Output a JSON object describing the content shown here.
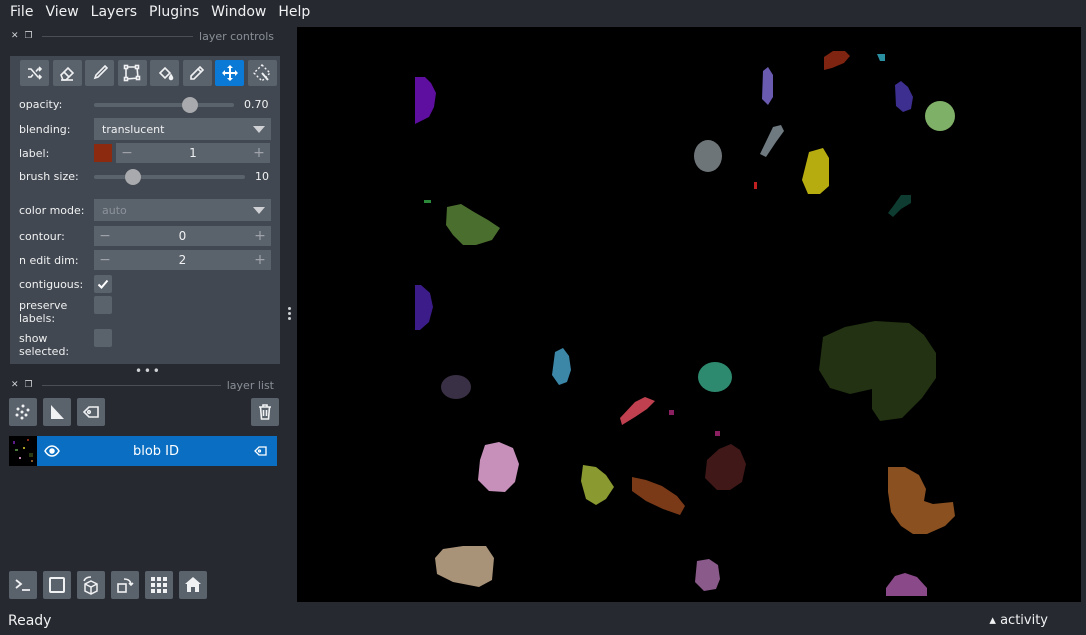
{
  "menu": [
    "File",
    "View",
    "Layers",
    "Plugins",
    "Window",
    "Help"
  ],
  "layer_controls": {
    "title": "layer controls",
    "tools": [
      {
        "icon": "shuffle-icon",
        "active": false
      },
      {
        "icon": "erase-icon",
        "active": false
      },
      {
        "icon": "paint-icon",
        "active": false
      },
      {
        "icon": "polygon-icon",
        "active": false
      },
      {
        "icon": "fill-icon",
        "active": false
      },
      {
        "icon": "picker-icon",
        "active": false
      },
      {
        "icon": "pan-zoom-icon",
        "active": true
      },
      {
        "icon": "transform-icon",
        "active": false
      }
    ],
    "opacity": {
      "label": "opacity:",
      "value": "0.70",
      "fraction": 0.7
    },
    "blending": {
      "label": "blending:",
      "value": "translucent"
    },
    "label": {
      "label": "label:",
      "value": "1",
      "color": "#8b2a0e"
    },
    "brush_size": {
      "label": "brush size:",
      "value": "10",
      "fraction": 0.25
    },
    "color_mode": {
      "label": "color mode:",
      "value": "auto"
    },
    "contour": {
      "label": "contour:",
      "value": "0"
    },
    "n_edit_dim": {
      "label": "n edit dim:",
      "value": "2"
    },
    "contiguous": {
      "label": "contiguous:",
      "checked": true
    },
    "preserve_labels": {
      "label": "preserve labels:",
      "checked": false
    },
    "show_selected": {
      "label": "show selected:",
      "checked": false
    }
  },
  "layer_list": {
    "title": "layer list",
    "layers": [
      {
        "name": "blob ID",
        "visible": true,
        "selected": true
      }
    ]
  },
  "status": {
    "text": "Ready",
    "activity": "activity"
  },
  "colors": {
    "accent": "#0a7ad6",
    "panel": "#414851",
    "background": "#262930"
  }
}
